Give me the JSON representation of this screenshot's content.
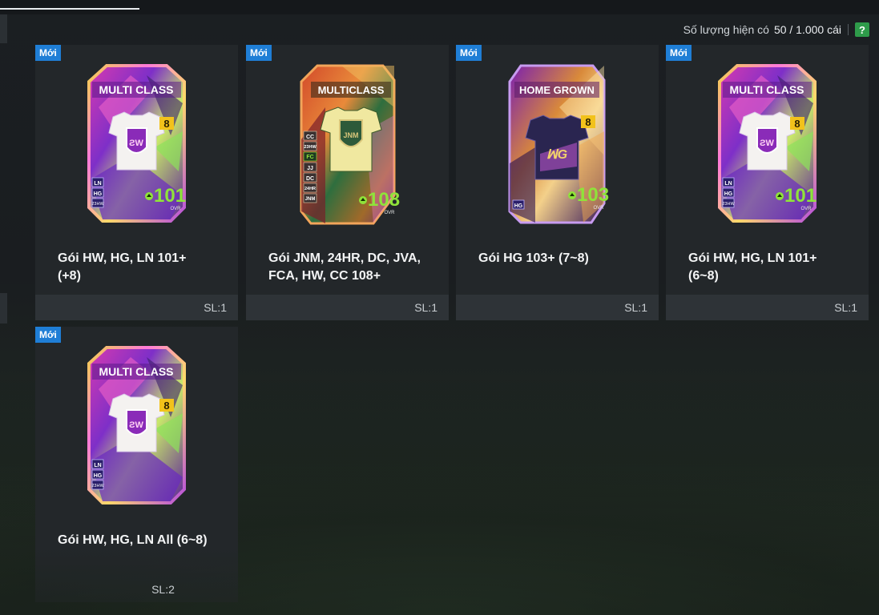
{
  "stock": {
    "label": "Số lượng hiện có",
    "value": "50 / 1.000 cái",
    "help": "?"
  },
  "colors": {
    "badge": "#1f7ed6",
    "help_button": "#2e9b4a",
    "ovr_green": "#8fe33a",
    "level_gold": "#f2c21b"
  },
  "items": [
    {
      "badge": "Mới",
      "title_line1": "Gói HW, HG, LN 101+",
      "title_line2": "(+8)",
      "qty": "SL:1",
      "pack": {
        "label": "MULTI CLASS",
        "level": "8",
        "ovr": "101",
        "ovr_label": "OVR",
        "tags": [
          "LN",
          "HG",
          "23HW"
        ]
      }
    },
    {
      "badge": "Mới",
      "title_line1": "Gói JNM, 24HR, DC, JVA,",
      "title_line2": "FCA, HW, CC 108+",
      "qty": "SL:1",
      "pack": {
        "label": "MULTICLASS",
        "level": "",
        "ovr": "108",
        "ovr_label": "OVR",
        "tags": [
          "CC",
          "23HW",
          "FC",
          "JJ",
          "DC",
          "24HR",
          "JNM"
        ]
      }
    },
    {
      "badge": "Mới",
      "title_line1": "Gói HG 103+ (7~8)",
      "title_line2": "",
      "qty": "SL:1",
      "pack": {
        "label": "HOME GROWN",
        "level": "8",
        "ovr": "103",
        "ovr_label": "OVR",
        "tags": [
          "HG"
        ]
      }
    },
    {
      "badge": "Mới",
      "title_line1": "Gói HW, HG, LN 101+",
      "title_line2": "(6~8)",
      "qty": "SL:1",
      "pack": {
        "label": "MULTI CLASS",
        "level": "8",
        "ovr": "101",
        "ovr_label": "OVR",
        "tags": [
          "LN",
          "HG",
          "23HW"
        ]
      }
    },
    {
      "badge": "Mới",
      "title_line1": "Gói HW, HG, LN All (6~8)",
      "title_line2": "",
      "qty": "SL:2",
      "pack": {
        "label": "MULTI CLASS",
        "level": "8",
        "ovr": "",
        "ovr_label": "",
        "tags": [
          "LN",
          "HG",
          "23HW"
        ]
      }
    }
  ]
}
